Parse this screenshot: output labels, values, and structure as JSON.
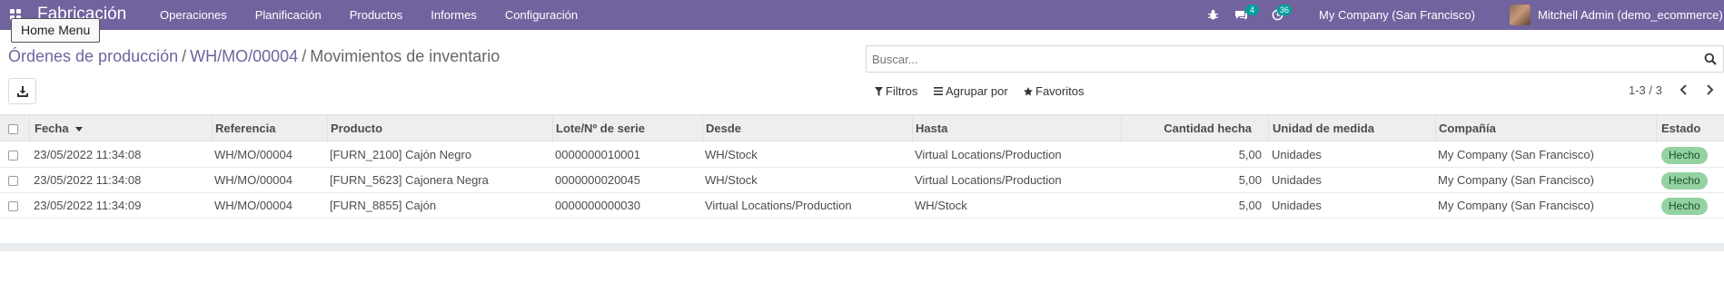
{
  "navbar": {
    "app_name": "Fabricación",
    "menu": [
      "Operaciones",
      "Planificación",
      "Productos",
      "Informes",
      "Configuración"
    ],
    "tooltip": "Home Menu",
    "messages_count": "4",
    "activities_count": "36",
    "company": "My Company (San Francisco)",
    "user": "Mitchell Admin (demo_ecommerce)"
  },
  "breadcrumb": {
    "items": [
      "Órdenes de producción",
      "WH/MO/00004"
    ],
    "separator": "/",
    "current": "Movimientos de inventario"
  },
  "search": {
    "placeholder": "Buscar..."
  },
  "filters": {
    "filters": "Filtros",
    "group_by": "Agrupar por",
    "favorites": "Favoritos"
  },
  "pager": {
    "text": "1-3 / 3"
  },
  "table": {
    "columns": [
      "Fecha",
      "Referencia",
      "Producto",
      "Lote/Nº de serie",
      "Desde",
      "Hasta",
      "Cantidad hecha",
      "Unidad de medida",
      "Compañía",
      "Estado"
    ],
    "rows": [
      [
        "23/05/2022 11:34:08",
        "WH/MO/00004",
        "[FURN_2100] Cajón Negro",
        "0000000010001",
        "WH/Stock",
        "Virtual Locations/Production",
        "5,00",
        "Unidades",
        "My Company (San Francisco)",
        "Hecho"
      ],
      [
        "23/05/2022 11:34:08",
        "WH/MO/00004",
        "[FURN_5623] Cajonera Negra",
        "0000000020045",
        "WH/Stock",
        "Virtual Locations/Production",
        "5,00",
        "Unidades",
        "My Company (San Francisco)",
        "Hecho"
      ],
      [
        "23/05/2022 11:34:09",
        "WH/MO/00004",
        "[FURN_8855] Cajón",
        "0000000000030",
        "Virtual Locations/Production",
        "WH/Stock",
        "5,00",
        "Unidades",
        "My Company (San Francisco)",
        "Hecho"
      ]
    ]
  },
  "colors": {
    "brand": "#71639e",
    "badge": "#00a09d",
    "status_done": "#94d2a2"
  },
  "icons": [
    "apps-grid-icon",
    "bug-icon",
    "chat-icon",
    "clock-icon",
    "search-icon",
    "download-icon",
    "filter-icon",
    "group-by-icon",
    "star-icon",
    "chevron-left-icon",
    "chevron-right-icon",
    "sort-desc-icon"
  ]
}
